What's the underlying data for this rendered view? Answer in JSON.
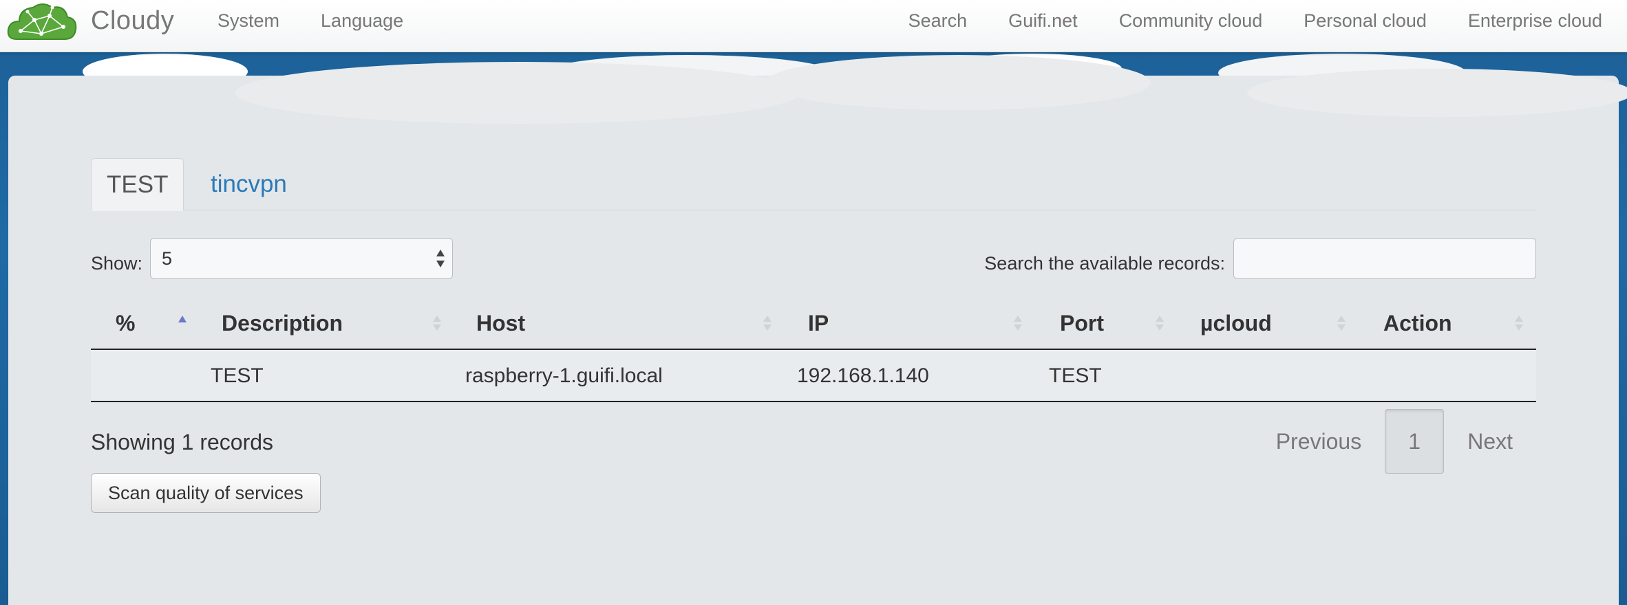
{
  "navbar": {
    "brand": "Cloudy",
    "left_items": [
      "System",
      "Language"
    ],
    "right_items": [
      "Search",
      "Guifi.net",
      "Community cloud",
      "Personal cloud",
      "Enterprise cloud"
    ]
  },
  "tabs": {
    "active": "TEST",
    "other": "tincvpn"
  },
  "controls": {
    "show_label": "Show:",
    "show_value": "5",
    "search_label": "Search the available records:",
    "search_value": ""
  },
  "table": {
    "headers": [
      "%",
      "Description",
      "Host",
      "IP",
      "Port",
      "µcloud",
      "Action"
    ],
    "rows": [
      {
        "percent": "",
        "description": "TEST",
        "host": "raspberry-1.guifi.local",
        "ip": "192.168.1.140",
        "port": "TEST",
        "ucloud": "",
        "action": ""
      }
    ]
  },
  "footer": {
    "showing": "Showing 1 records",
    "previous": "Previous",
    "page": "1",
    "next": "Next"
  },
  "scan_button": "Scan quality of services",
  "colors": {
    "background_blue": "#1f6aa5",
    "panel": "#e4e7ea",
    "link": "#2a7ab8",
    "logo_green": "#5aa83c"
  }
}
